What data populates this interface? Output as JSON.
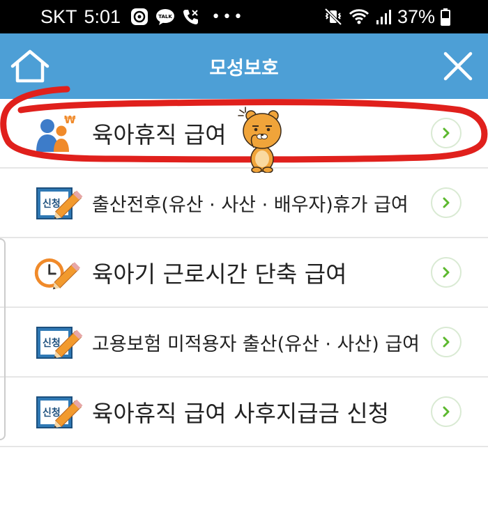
{
  "status_bar": {
    "carrier": "SKT",
    "time": "5:01",
    "battery": "37%",
    "icons_left": [
      "compass-icon",
      "kakaotalk-icon",
      "call-icon",
      "more-icon"
    ],
    "icons_right": [
      "vibrate-mute-icon",
      "wifi-icon",
      "signal-icon",
      "battery-icon"
    ]
  },
  "header": {
    "title": "모성보호",
    "home_icon": "home-icon",
    "close_icon": "close-icon",
    "background": "#4d9fd6"
  },
  "menu": {
    "items": [
      {
        "label": "육아휴직 급여",
        "icon": "parental-leave-icon"
      },
      {
        "label": "출산전후(유산 · 사산 · 배우자)휴가 급여",
        "icon": "application-pencil-icon"
      },
      {
        "label": "육아기 근로시간 단축 급여",
        "icon": "clock-pencil-icon"
      },
      {
        "label": "고용보험 미적용자 출산(유산 · 사산) 급여",
        "icon": "application-pencil-icon"
      },
      {
        "label": "육아휴직 급여 사후지급금 신청",
        "icon": "application-pencil-icon"
      }
    ]
  },
  "annotation": {
    "color": "#e0201c",
    "sticker": "ryan-character-sticker"
  },
  "icon_text": {
    "application": "신청",
    "won": "₩"
  },
  "colors": {
    "chevron": "#5cb82e",
    "chevron_ring": "#d9ead3",
    "divider": "#e6e6e6"
  }
}
